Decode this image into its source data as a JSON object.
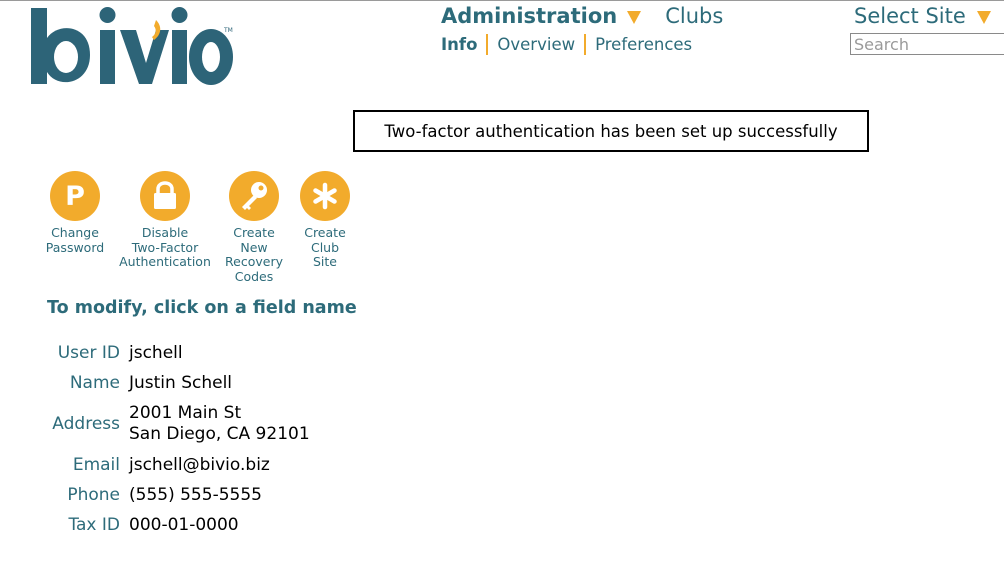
{
  "brand": {
    "logo_text": "bivio",
    "trademark": "TM"
  },
  "nav": {
    "main": {
      "administration": "Administration",
      "clubs": "Clubs"
    },
    "sub": {
      "info": "Info",
      "overview": "Overview",
      "preferences": "Preferences"
    },
    "select_site": "Select Site",
    "search_placeholder": "Search"
  },
  "message": "Two-factor authentication has been set up successfully",
  "actions": [
    {
      "label": "Change\nPassword",
      "icon": "p-icon"
    },
    {
      "label": "Disable\nTwo-Factor\nAuthentication",
      "icon": "lock-icon"
    },
    {
      "label": "Create\nNew\nRecovery\nCodes",
      "icon": "key-icon"
    },
    {
      "label": "Create\nClub\nSite",
      "icon": "asterisk-icon"
    }
  ],
  "section_title": "To modify, click on a field name",
  "fields": {
    "user_id": {
      "label": "User ID",
      "value": "jschell"
    },
    "name": {
      "label": "Name",
      "value": "Justin Schell"
    },
    "address": {
      "label": "Address",
      "line1": "2001 Main St",
      "line2": "San Diego, CA 92101"
    },
    "email": {
      "label": "Email",
      "value": "jschell@bivio.biz"
    },
    "phone": {
      "label": "Phone",
      "value": "(555) 555-5555"
    },
    "tax_id": {
      "label": "Tax ID",
      "value": "000-01-0000"
    }
  },
  "colors": {
    "accent": "#f2ab2c",
    "link": "#2d6b7a",
    "logo": "#2d6478"
  }
}
